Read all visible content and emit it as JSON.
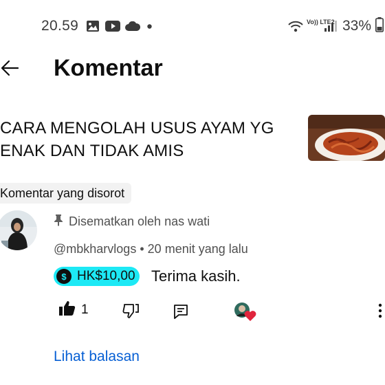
{
  "status_bar": {
    "time": "20.59",
    "battery": "33%",
    "network_label": "Vo)) LTE2",
    "icons": [
      "gallery-icon",
      "youtube-icon",
      "cloud-icon",
      "dot-icon",
      "wifi-icon",
      "signal-icon",
      "battery-icon"
    ]
  },
  "header": {
    "back_icon": "arrow-left-icon",
    "title": "Komentar"
  },
  "video": {
    "title": "CARA MENGOLAH USUS AYAM YG ENAK DAN TIDAK AMIS"
  },
  "highlight_chip": "Komentar yang disorot",
  "comment": {
    "pinned_label": "Disematkan oleh nas wati",
    "author": "@mbkharvlogs",
    "separator": "•",
    "time": "20 menit yang lalu",
    "super_thanks_amount": "HK$10,00",
    "text": "Terima kasih.",
    "like_count": "1",
    "view_replies": "Lihat balasan"
  },
  "colors": {
    "super_thanks_bg": "#1de9f5",
    "link": "#065fd4",
    "heart": "#e0243c"
  }
}
